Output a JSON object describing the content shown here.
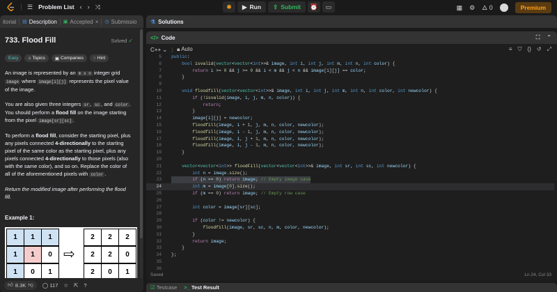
{
  "topbar": {
    "problem_list": "Problem List",
    "run": "Run",
    "submit": "Submit",
    "fire_count": "0",
    "premium": "Premium"
  },
  "left": {
    "tabs": [
      {
        "label": "itorial"
      },
      {
        "label": "Description"
      },
      {
        "label": "Accepted"
      },
      {
        "label": "Submissio"
      }
    ],
    "title": "733. Flood Fill",
    "solved": "Solved",
    "chips": [
      "Easy",
      "Topics",
      "Companies",
      "Hint"
    ],
    "p1_a": "An image is represented by an ",
    "p1_code1": "m x n",
    "p1_b": " integer grid ",
    "p1_code2": "image",
    "p1_c": " where ",
    "p1_code3": "image[i][j]",
    "p1_d": " represents the pixel value of the image.",
    "p2_a": "You are also given three integers ",
    "p2_code1": "sr",
    "p2_b": ", ",
    "p2_code2": "sc",
    "p2_c": ", and ",
    "p2_code3": "color",
    "p2_d": ". You should perform a ",
    "p2_bold": "flood fill",
    "p2_e": " on the image starting from the pixel ",
    "p2_code4": "image[sr][sc]",
    "p2_f": ".",
    "p3_a": "To perform a ",
    "p3_b1": "flood fill",
    "p3_b": ", consider the starting pixel, plus any pixels connected ",
    "p3_b2": "4-directionally",
    "p3_c": " to the starting pixel of the same color as the starting pixel, plus any pixels connected ",
    "p3_b3": "4-directionally",
    "p3_d": " to those pixels (also with the same color), and so on. Replace the color of all of the aforementioned pixels with ",
    "p3_code": "color",
    "p3_e": ".",
    "p4": "Return the modified image after performing the flood fill.",
    "example": "Example 1:",
    "grid_before": [
      [
        "1",
        "1",
        "1"
      ],
      [
        "1",
        "1",
        "0"
      ],
      [
        "1",
        "0",
        "1"
      ]
    ],
    "grid_after": [
      [
        "2",
        "2",
        "2"
      ],
      [
        "2",
        "2",
        "0"
      ],
      [
        "2",
        "0",
        "1"
      ]
    ],
    "likes": "8.3K",
    "comments": "117"
  },
  "right": {
    "solutions": "Solutions",
    "code": "Code",
    "lang": "C++",
    "auto": "Auto",
    "saved": "Saved",
    "cursor": "Ln 24, Col 33",
    "testcase": "Testcase",
    "test_result": "Test Result"
  },
  "code_lines": [
    {
      "n": "5",
      "html": "<span class='k'>public</span>:"
    },
    {
      "n": "6",
      "html": "    <span class='k'>bool</span> <span class='f'>isvalid</span>(<span class='t'>vector</span>&lt;<span class='t'>vector</span>&lt;<span class='k'>int</span>&gt;&gt;&amp; <span class='v'>image</span>, <span class='k'>int</span> <span class='v'>i</span>, <span class='k'>int</span> <span class='v'>j</span>, <span class='k'>int</span> <span class='v'>m</span>, <span class='k'>int</span> <span class='v'>n</span>, <span class='k'>int</span> <span class='v'>color</span>) {"
    },
    {
      "n": "7",
      "html": "        <span class='cf'>return</span> <span class='v'>i</span> &gt;= <span class='n'>0</span> &amp;&amp; <span class='v'>j</span> &gt;= <span class='n'>0</span> &amp;&amp; <span class='v'>i</span> &lt; <span class='v'>m</span> &amp;&amp; <span class='v'>j</span> &lt; <span class='v'>n</span> &amp;&amp; <span class='v'>image</span>[<span class='v'>i</span>][<span class='v'>j</span>] == <span class='v'>color</span>;"
    },
    {
      "n": "8",
      "html": "    }"
    },
    {
      "n": "9",
      "html": ""
    },
    {
      "n": "10",
      "html": "    <span class='k'>void</span> <span class='f'>floodfill</span>(<span class='t'>vector</span>&lt;<span class='t'>vector</span>&lt;<span class='k'>int</span>&gt;&gt;&amp; <span class='v'>image</span>, <span class='k'>int</span> <span class='v'>i</span>, <span class='k'>int</span> <span class='v'>j</span>, <span class='k'>int</span> <span class='v'>m</span>, <span class='k'>int</span> <span class='v'>n</span>, <span class='k'>int</span> <span class='v'>color</span>, <span class='k'>int</span> <span class='v'>newcolor</span>) {"
    },
    {
      "n": "11",
      "html": "        <span class='cf'>if</span> (!<span class='f'>isvalid</span>(<span class='v'>image</span>, <span class='v'>i</span>, <span class='v'>j</span>, <span class='v'>m</span>, <span class='v'>n</span>, <span class='v'>color</span>)) {"
    },
    {
      "n": "12",
      "html": "            <span class='cf'>return</span>;"
    },
    {
      "n": "13",
      "html": "        }"
    },
    {
      "n": "14",
      "html": "        <span class='v'>image</span>[<span class='v'>i</span>][<span class='v'>j</span>] = <span class='v'>newcolor</span>;"
    },
    {
      "n": "15",
      "html": "        <span class='f'>floodfill</span>(<span class='v'>image</span>, <span class='v'>i</span> + <span class='n'>1</span>, <span class='v'>j</span>, <span class='v'>m</span>, <span class='v'>n</span>, <span class='v'>color</span>, <span class='v'>newcolor</span>);"
    },
    {
      "n": "16",
      "html": "        <span class='f'>floodfill</span>(<span class='v'>image</span>, <span class='v'>i</span> - <span class='n'>1</span>, <span class='v'>j</span>, <span class='v'>m</span>, <span class='v'>n</span>, <span class='v'>color</span>, <span class='v'>newcolor</span>);"
    },
    {
      "n": "17",
      "html": "        <span class='f'>floodfill</span>(<span class='v'>image</span>, <span class='v'>i</span>, <span class='v'>j</span> + <span class='n'>1</span>, <span class='v'>m</span>, <span class='v'>n</span>, <span class='v'>color</span>, <span class='v'>newcolor</span>);"
    },
    {
      "n": "18",
      "html": "        <span class='f'>floodfill</span>(<span class='v'>image</span>, <span class='v'>i</span>, <span class='v'>j</span> - <span class='n'>1</span>, <span class='v'>m</span>, <span class='v'>n</span>, <span class='v'>color</span>, <span class='v'>newcolor</span>);"
    },
    {
      "n": "19",
      "html": "    }"
    },
    {
      "n": "20",
      "html": ""
    },
    {
      "n": "21",
      "html": "    <span class='t'>vector</span>&lt;<span class='t'>vector</span>&lt;<span class='k'>int</span>&gt;&gt; <span class='f'>floodFill</span>(<span class='t'>vector</span>&lt;<span class='t'>vector</span>&lt;<span class='k'>int</span>&gt;&gt;&amp; <span class='v'>image</span>, <span class='k'>int</span> <span class='v'>sr</span>, <span class='k'>int</span> <span class='v'>sc</span>, <span class='k'>int</span> <span class='v'>newcolor</span>) {"
    },
    {
      "n": "22",
      "html": "        <span class='k'>int</span> <span class='v'>n</span> = <span class='v'>image</span>.<span class='f'>size</span>();"
    },
    {
      "n": "23",
      "html": "        <span class='cf'>if</span> (<span class='v'>n</span> == <span class='n'>0</span>) <span class='cf'>return</span> <span class='v'>image</span>; <span class='c'>// Empty image case</span>"
    },
    {
      "n": "24",
      "html": "        <span class='k'>int</span> <span class='v'>m</span> = <span class='v'>image</span>[<span class='n'>0</span>].<span class='f'>size</span>();"
    },
    {
      "n": "25",
      "html": "        <span class='cf'>if</span> (<span class='v'>m</span> == <span class='n'>0</span>) <span class='cf'>return</span> <span class='v'>image</span>; <span class='c'>// Empty row case</span>"
    },
    {
      "n": "26",
      "html": ""
    },
    {
      "n": "27",
      "html": "        <span class='k'>int</span> <span class='v'>color</span> = <span class='v'>image</span>[<span class='v'>sr</span>][<span class='v'>sc</span>];"
    },
    {
      "n": "28",
      "html": ""
    },
    {
      "n": "29",
      "html": "        <span class='cf'>if</span> (<span class='v'>color</span> != <span class='v'>newcolor</span>) {"
    },
    {
      "n": "30",
      "html": "            <span class='f'>floodfill</span>(<span class='v'>image</span>, <span class='v'>sr</span>, <span class='v'>sc</span>, <span class='v'>n</span>, <span class='v'>m</span>, <span class='v'>color</span>, <span class='v'>newcolor</span>);"
    },
    {
      "n": "31",
      "html": "        }"
    },
    {
      "n": "32",
      "html": "        <span class='cf'>return</span> <span class='v'>image</span>;"
    },
    {
      "n": "33",
      "html": "    }"
    },
    {
      "n": "34",
      "html": "};"
    },
    {
      "n": "35",
      "html": ""
    },
    {
      "n": "36",
      "html": ""
    }
  ]
}
